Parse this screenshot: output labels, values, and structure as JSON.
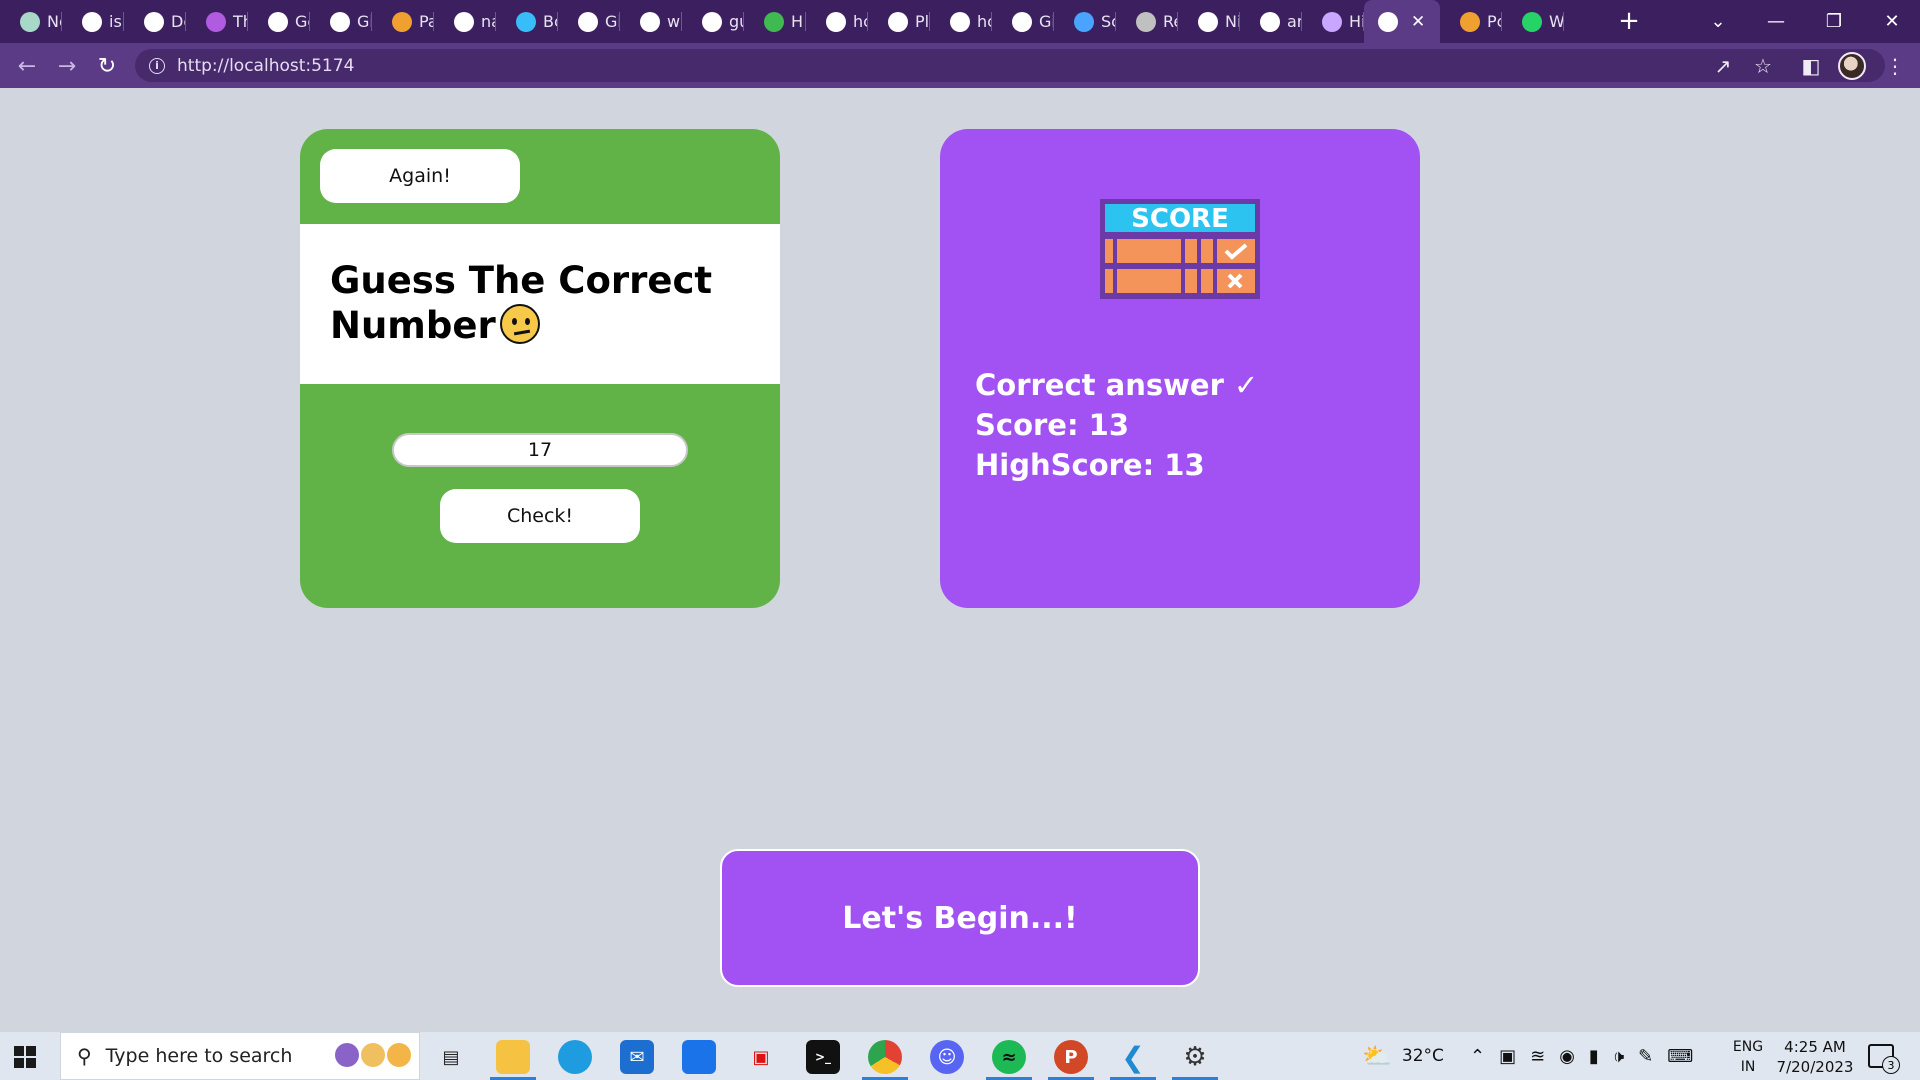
{
  "browser": {
    "tabs": [
      {
        "label": "Ne",
        "icon": "chatgpt-icon",
        "color": "#a8d8c8"
      },
      {
        "label": "is",
        "icon": "google-icon",
        "color": "#ffffff"
      },
      {
        "label": "Dc",
        "icon": "web-icon",
        "color": "#ffffff"
      },
      {
        "label": "Th",
        "icon": "u-icon",
        "color": "#b05be0"
      },
      {
        "label": "Gc",
        "icon": "google-icon",
        "color": "#ffffff"
      },
      {
        "label": "Gi",
        "icon": "web-icon",
        "color": "#ffffff"
      },
      {
        "label": "Pa",
        "icon": "zoho-icon",
        "color": "#f0a030"
      },
      {
        "label": "na",
        "icon": "google-icon",
        "color": "#ffffff"
      },
      {
        "label": "Bc",
        "icon": "tailwind-icon",
        "color": "#38bdf8"
      },
      {
        "label": "Gi",
        "icon": "web-icon",
        "color": "#ffffff"
      },
      {
        "label": "wi",
        "icon": "google-icon",
        "color": "#ffffff"
      },
      {
        "label": "gu",
        "icon": "google-icon",
        "color": "#ffffff"
      },
      {
        "label": "H",
        "icon": "w-icon",
        "color": "#3fb950"
      },
      {
        "label": "hc",
        "icon": "google-icon",
        "color": "#ffffff"
      },
      {
        "label": "Pl",
        "icon": "codepen-icon",
        "color": "#ffffff"
      },
      {
        "label": "hc",
        "icon": "google-icon",
        "color": "#ffffff"
      },
      {
        "label": "Gi",
        "icon": "google-icon",
        "color": "#ffffff"
      },
      {
        "label": "Sc",
        "icon": "vite-icon",
        "color": "#4aa3ff"
      },
      {
        "label": "Re",
        "icon": "layers-icon",
        "color": "#c0c0c0"
      },
      {
        "label": "Ni",
        "icon": "web-icon",
        "color": "#ffffff"
      },
      {
        "label": "ar",
        "icon": "google-icon",
        "color": "#ffffff"
      },
      {
        "label": "Hi",
        "icon": "rocket-icon",
        "color": "#c9a6ff"
      },
      {
        "label": "",
        "icon": "web-icon",
        "color": "#ffffff",
        "active": true
      },
      {
        "label": "Pc",
        "icon": "zoho-icon",
        "color": "#f0a030"
      },
      {
        "label": "W",
        "icon": "whatsapp-icon",
        "color": "#25d366"
      }
    ],
    "url": "http://localhost:5174"
  },
  "page": {
    "again_label": "Again!",
    "title": "Guess The Correct Number",
    "guess_value": "17",
    "check_label": "Check!",
    "logo_text": "SCORE",
    "status_message": "Correct answer ✓",
    "score_text": "Score: 13",
    "highscore_text": "HighScore: 13",
    "begin_label": "Let's Begin...!"
  },
  "colors": {
    "page_bg": "#d1d5de",
    "game_card": "#61b348",
    "score_card": "#a252f2",
    "tab_bar": "#3b1f5e",
    "address_bar": "#5b3a86"
  },
  "taskbar": {
    "search_placeholder": "Type here to search",
    "weather": "32°C",
    "lang_line1": "ENG",
    "lang_line2": "IN",
    "time": "4:25 AM",
    "date": "7/20/2023",
    "notification_count": "3"
  }
}
